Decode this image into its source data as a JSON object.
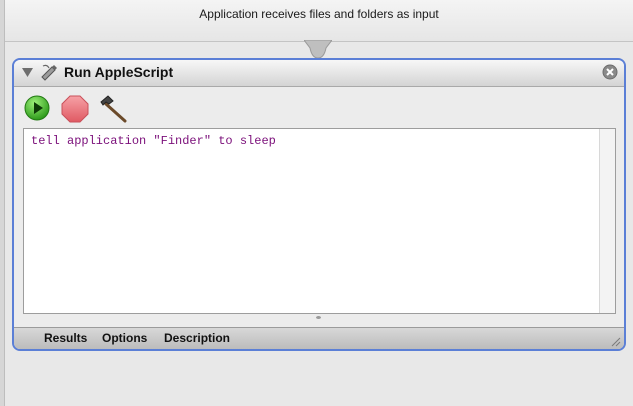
{
  "workflow": {
    "input_description": "Application receives files and folders as input"
  },
  "action": {
    "title": "Run AppleScript",
    "accent_color": "#5b7fd6",
    "icons": {
      "disclosure": "disclosure-triangle-icon",
      "action": "applescript-icon",
      "close": "close-icon"
    },
    "toolbar": {
      "run_icon": "play-icon",
      "stop_icon": "stop-icon",
      "compile_icon": "hammer-icon"
    },
    "script": "tell application \"Finder\" to sleep",
    "tabs": [
      {
        "label": "Results"
      },
      {
        "label": "Options"
      },
      {
        "label": "Description"
      }
    ]
  }
}
